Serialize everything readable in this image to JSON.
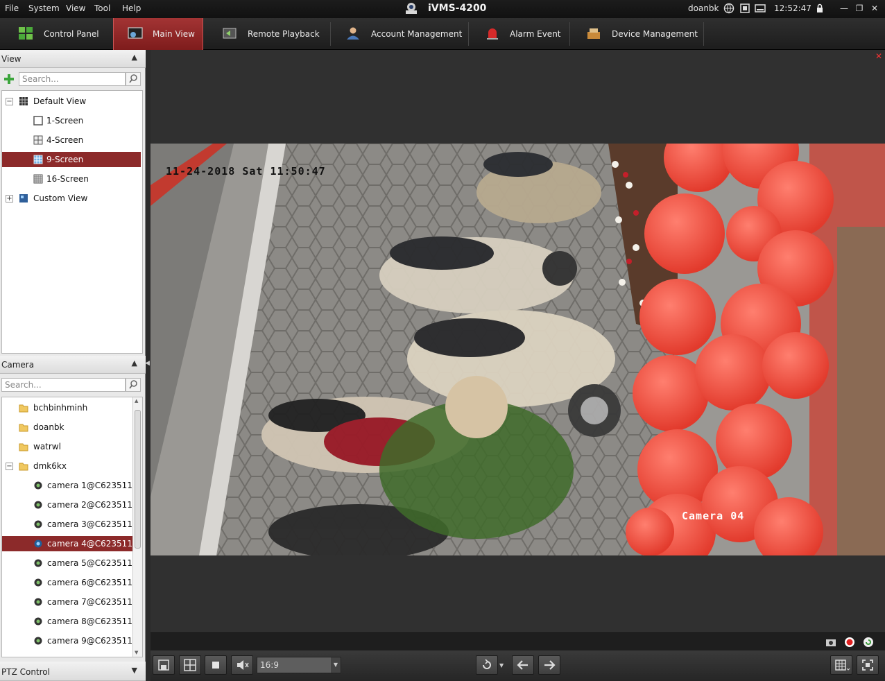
{
  "app": {
    "title": "iVMS-4200"
  },
  "menu": [
    "File",
    "System",
    "View",
    "Tool",
    "Help"
  ],
  "status": {
    "user": "doanbk",
    "time": "12:52:47"
  },
  "tabs": [
    {
      "label": "Control Panel",
      "icon": "control-panel-icon"
    },
    {
      "label": "Main View",
      "icon": "main-view-icon",
      "active": true
    },
    {
      "label": "Remote Playback",
      "icon": "remote-playback-icon"
    },
    {
      "label": "Account Management",
      "icon": "account-management-icon"
    },
    {
      "label": "Alarm Event",
      "icon": "alarm-event-icon"
    },
    {
      "label": "Device Management",
      "icon": "device-management-icon"
    }
  ],
  "view_panel": {
    "title": "View",
    "search_placeholder": "Search...",
    "items": [
      {
        "label": "Default View"
      },
      {
        "label": "1-Screen"
      },
      {
        "label": "4-Screen"
      },
      {
        "label": "9-Screen",
        "selected": true
      },
      {
        "label": "16-Screen"
      },
      {
        "label": "Custom View"
      }
    ]
  },
  "camera_panel": {
    "title": "Camera",
    "search_placeholder": "Search...",
    "items": [
      {
        "label": "bchbinhminh"
      },
      {
        "label": "doanbk"
      },
      {
        "label": "watrwl"
      },
      {
        "label": "dmk6kx"
      },
      {
        "label": "camera 1@C623511..."
      },
      {
        "label": "camera 2@C623511..."
      },
      {
        "label": "camera 3@C623511..."
      },
      {
        "label": "camera 4@C623511...",
        "selected": true
      },
      {
        "label": "camera 5@C623511..."
      },
      {
        "label": "camera 6@C623511..."
      },
      {
        "label": "camera 7@C623511..."
      },
      {
        "label": "camera 8@C623511..."
      },
      {
        "label": "camera 9@C623511..."
      }
    ]
  },
  "ptz": {
    "title": "PTZ Control"
  },
  "video": {
    "osd_datetime": "11-24-2018  Sat  11:50:47",
    "osd_camera": "Camera 04"
  },
  "toolbar": {
    "aspect_ratio": "16:9"
  },
  "colors": {
    "accent": "#8c2a2a",
    "tab_active": "#8e2626"
  }
}
